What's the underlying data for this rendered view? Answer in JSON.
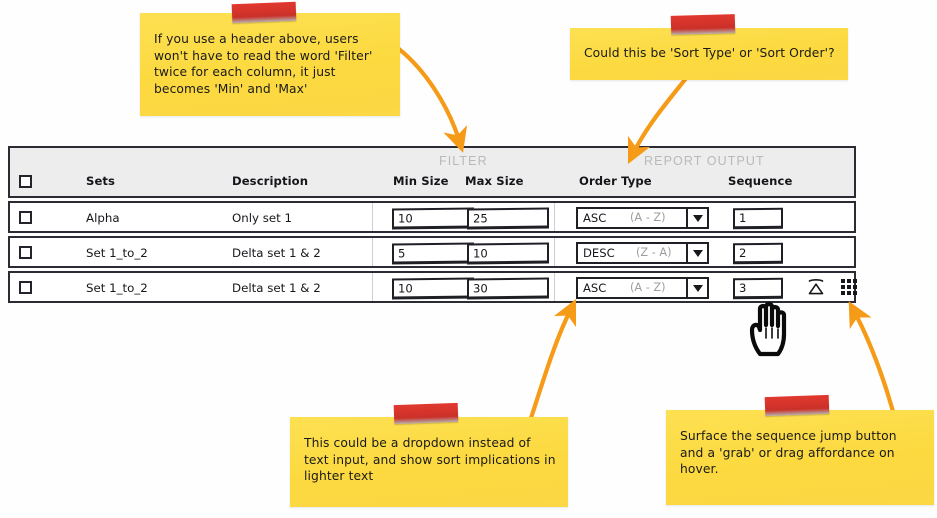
{
  "table": {
    "group_headers": [
      {
        "label": "FILTER"
      },
      {
        "label": "REPORT OUTPUT"
      }
    ],
    "columns": [
      {
        "key": "select",
        "label": ""
      },
      {
        "key": "sets",
        "label": "Sets"
      },
      {
        "key": "description",
        "label": "Description"
      },
      {
        "key": "min_size",
        "label": "Min Size"
      },
      {
        "key": "max_size",
        "label": "Max Size"
      },
      {
        "key": "order_type",
        "label": "Order Type"
      },
      {
        "key": "sequence",
        "label": "Sequence"
      }
    ],
    "rows": [
      {
        "sets": "Alpha",
        "description": "Only set 1",
        "min_size": "10",
        "max_size": "25",
        "order_type": "ASC",
        "order_type_hint": "(A - Z)",
        "sequence": "1",
        "show_row_icons": false
      },
      {
        "sets": "Set 1_to_2",
        "description": "Delta set 1 & 2",
        "min_size": "5",
        "max_size": "10",
        "order_type": "DESC",
        "order_type_hint": "(Z - A)",
        "sequence": "2",
        "show_row_icons": false
      },
      {
        "sets": "Set 1_to_2",
        "description": "Delta set 1 & 2",
        "min_size": "10",
        "max_size": "30",
        "order_type": "ASC",
        "order_type_hint": "(A - Z)",
        "sequence": "3",
        "show_row_icons": true
      }
    ],
    "row_icons": [
      {
        "name": "sequence-jump-icon"
      },
      {
        "name": "drag-grab-handle-icon"
      }
    ]
  },
  "annotations": [
    {
      "id": "note-filter-header",
      "text": "If you use a header above, users won't have to read the word 'Filter' twice for each column, it just becomes 'Min' and 'Max'"
    },
    {
      "id": "note-sort-type",
      "text": "Could this be 'Sort Type' or 'Sort Order'?"
    },
    {
      "id": "note-dropdown",
      "text": "This could be a dropdown instead of text input, and show sort implications in lighter text"
    },
    {
      "id": "note-sequence-jump",
      "text": "Surface the sequence jump button and a 'grab' or drag affordance on hover."
    }
  ],
  "colors": {
    "note_yellow": "#fcdf4c",
    "tape_red": "#d6342b",
    "arrow_orange": "#f59b17",
    "header_gray": "#ededed",
    "group_label_gray": "#b9b9b9",
    "border_dark": "#2b2b33",
    "hint_gray": "#9d9d9d"
  },
  "cursor": {
    "type": "pointing-hand"
  }
}
